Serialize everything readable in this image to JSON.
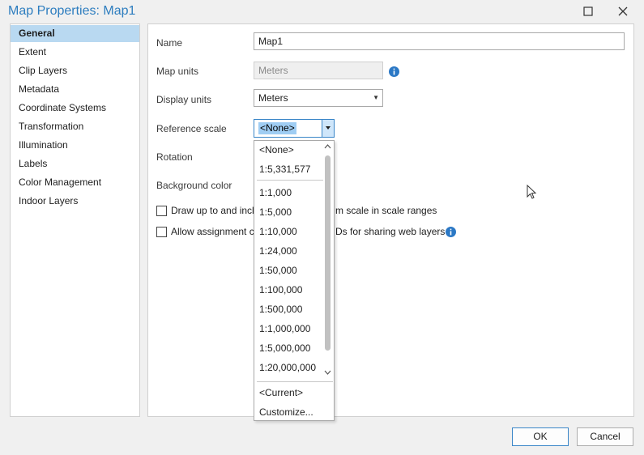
{
  "window": {
    "title": "Map Properties: Map1"
  },
  "nav": {
    "items": [
      {
        "label": "General"
      },
      {
        "label": "Extent"
      },
      {
        "label": "Clip Layers"
      },
      {
        "label": "Metadata"
      },
      {
        "label": "Coordinate Systems"
      },
      {
        "label": "Transformation"
      },
      {
        "label": "Illumination"
      },
      {
        "label": "Labels"
      },
      {
        "label": "Color Management"
      },
      {
        "label": "Indoor Layers"
      }
    ],
    "selected": "General"
  },
  "general": {
    "name_label": "Name",
    "name_value": "Map1",
    "map_units_label": "Map units",
    "map_units_value": "Meters",
    "display_units_label": "Display units",
    "display_units_value": "Meters",
    "reference_scale_label": "Reference scale",
    "reference_scale_value": "<None>",
    "rotation_label": "Rotation",
    "background_color_label": "Background color",
    "checkbox_draw_label": "Draw up to and incl",
    "checkbox_draw_label_tail": "m scale in scale ranges",
    "checkbox_allow_label": "Allow assignment c",
    "checkbox_allow_label_tail": "Ds for sharing web layers"
  },
  "reference_scale_dropdown": {
    "items": [
      "<None>",
      "1:5,331,577",
      "1:1,000",
      "1:5,000",
      "1:10,000",
      "1:24,000",
      "1:50,000",
      "1:100,000",
      "1:500,000",
      "1:1,000,000",
      "1:5,000,000",
      "1:20,000,000"
    ],
    "extra_items": [
      "<Current>",
      "Customize..."
    ]
  },
  "buttons": {
    "ok": "OK",
    "cancel": "Cancel"
  },
  "colors": {
    "accent": "#2d7dbf",
    "selection": "#b9d9f1",
    "info": "#2b78c5"
  }
}
